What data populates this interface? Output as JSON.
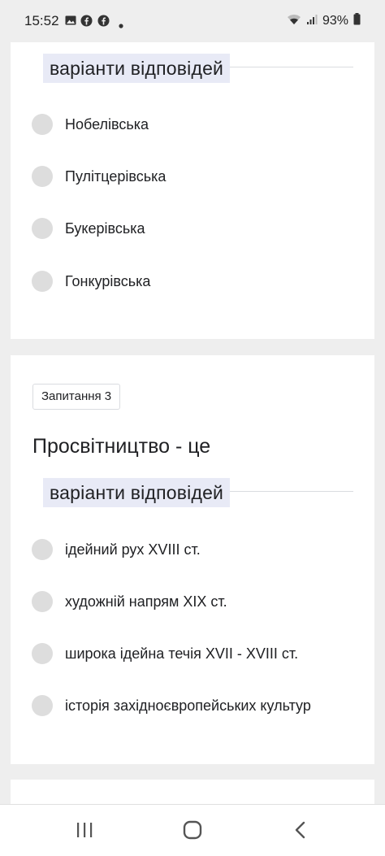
{
  "status_bar": {
    "time": "15:52",
    "battery": "93%"
  },
  "card1": {
    "section_label": "варіанти відповідей",
    "options": [
      "Нобелівська",
      "Пулітцерівська",
      "Букерівська",
      "Гонкурівська"
    ]
  },
  "card2": {
    "badge": "Запитання 3",
    "question": "Просвітництво - це",
    "section_label": "варіанти відповідей",
    "options": [
      " ідейний рух XVIII ст.",
      "художній напрям XIX ст.",
      "широка ідейна течія XVII - XVIII ст.",
      "історія західноєвропейських культур"
    ]
  },
  "icons": {
    "status": [
      "gallery-icon",
      "facebook-icon",
      "facebook-icon",
      "dot-icon",
      "wifi-icon",
      "signal-icon",
      "battery-icon"
    ],
    "nav": [
      "recents-icon",
      "home-icon",
      "back-icon"
    ]
  },
  "colors": {
    "page_bg": "#eeeeee",
    "card_bg": "#ffffff",
    "section_header_bg": "#e8eaf6",
    "radio": "#dddddd"
  }
}
